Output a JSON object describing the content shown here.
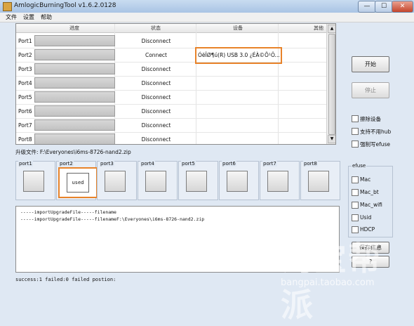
{
  "window": {
    "title": "AmlogicBurningTool  v1.6.2.0128",
    "minimize": "—",
    "maximize": "☐",
    "close": "✕"
  },
  "menu": [
    "文件",
    "设置",
    "帮助"
  ],
  "table": {
    "headers": [
      "进度",
      "状态",
      "设备",
      "其他"
    ],
    "rows": [
      {
        "port": "Port1",
        "status": "Disconnect",
        "device": ""
      },
      {
        "port": "Port2",
        "status": "Connect",
        "device": "ÓëÎØ¶ú(R) USB 3.0 ¿ÉÀ©Õ¹Ö..."
      },
      {
        "port": "Port3",
        "status": "Disconnect",
        "device": ""
      },
      {
        "port": "Port4",
        "status": "Disconnect",
        "device": ""
      },
      {
        "port": "Port5",
        "status": "Disconnect",
        "device": ""
      },
      {
        "port": "Port6",
        "status": "Disconnect",
        "device": ""
      },
      {
        "port": "Port7",
        "status": "Disconnect",
        "device": ""
      },
      {
        "port": "Port8",
        "status": "Disconnect",
        "device": ""
      }
    ]
  },
  "buttons": {
    "start": "开始",
    "stop": "停止",
    "save": "保存信息",
    "extra": "?"
  },
  "options": [
    "擦除设备",
    "支持不用hub",
    "强制写efuse"
  ],
  "upgrade_file": "升级文件: F:\\Everyones\\i6ms-8726-nand2.zip",
  "ports": [
    {
      "label": "port1",
      "used": false
    },
    {
      "label": "port2",
      "used": true
    },
    {
      "label": "port3",
      "used": false
    },
    {
      "label": "port4",
      "used": false
    },
    {
      "label": "port5",
      "used": false
    },
    {
      "label": "port6",
      "used": false
    },
    {
      "label": "port7",
      "used": false
    },
    {
      "label": "port8",
      "used": false
    }
  ],
  "used_label": "used",
  "efuse": {
    "title": "efuse",
    "items": [
      "Mac",
      "Mac_bt",
      "Mac_wifi",
      "Usid",
      "HDCP"
    ]
  },
  "log": [
    "-----importUpgradeFile-----filename",
    "-----importUpgradeFile-----filenameF:\\Everyones\\i6ms-8726-nand2.zip"
  ],
  "status_line": "success:1 failed:0 failed postion:",
  "watermark": {
    "cn": "淘宝帮派",
    "url": "bangpai.taobao.com"
  },
  "colors": {
    "highlight": "#e8832a",
    "background": "#dfe8f3"
  }
}
